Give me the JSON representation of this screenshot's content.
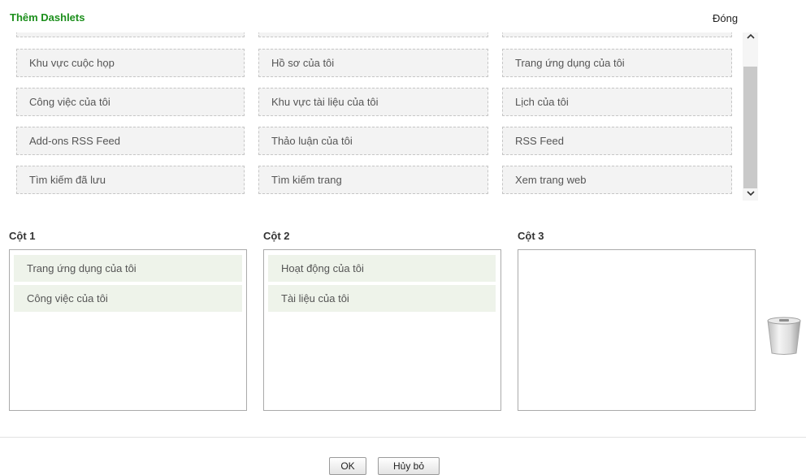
{
  "header": {
    "title": "Thêm Dashlets",
    "close_label": "Đóng"
  },
  "available_dashlets": [
    [
      "Khu vực cuộc họp",
      "Hồ sơ của tôi",
      "Trang ứng dụng của tôi"
    ],
    [
      "Công việc của tôi",
      "Khu vực tài liệu của tôi",
      "Lịch của tôi"
    ],
    [
      "Add-ons RSS Feed",
      "Thảo luận của tôi",
      "RSS Feed"
    ],
    [
      "Tìm kiếm đã lưu",
      "Tìm kiếm trang",
      "Xem trang web"
    ]
  ],
  "columns": [
    {
      "label": "Cột 1",
      "items": [
        "Trang ứng dụng của tôi",
        "Công việc của tôi"
      ]
    },
    {
      "label": "Cột 2",
      "items": [
        "Hoạt động của tôi",
        "Tài liệu của tôi"
      ]
    },
    {
      "label": "Cột 3",
      "items": []
    }
  ],
  "icons": {
    "scroll_up": "chevron-up-icon",
    "scroll_down": "chevron-down-icon",
    "trash": "trash-bin-icon"
  },
  "buttons": {
    "ok_label": "OK",
    "cancel_label": "Hủy bỏ"
  },
  "colors": {
    "title": "#1c8f1c",
    "dashlet_bg": "#f3f3f3",
    "column_item_bg": "#eef3ea"
  }
}
